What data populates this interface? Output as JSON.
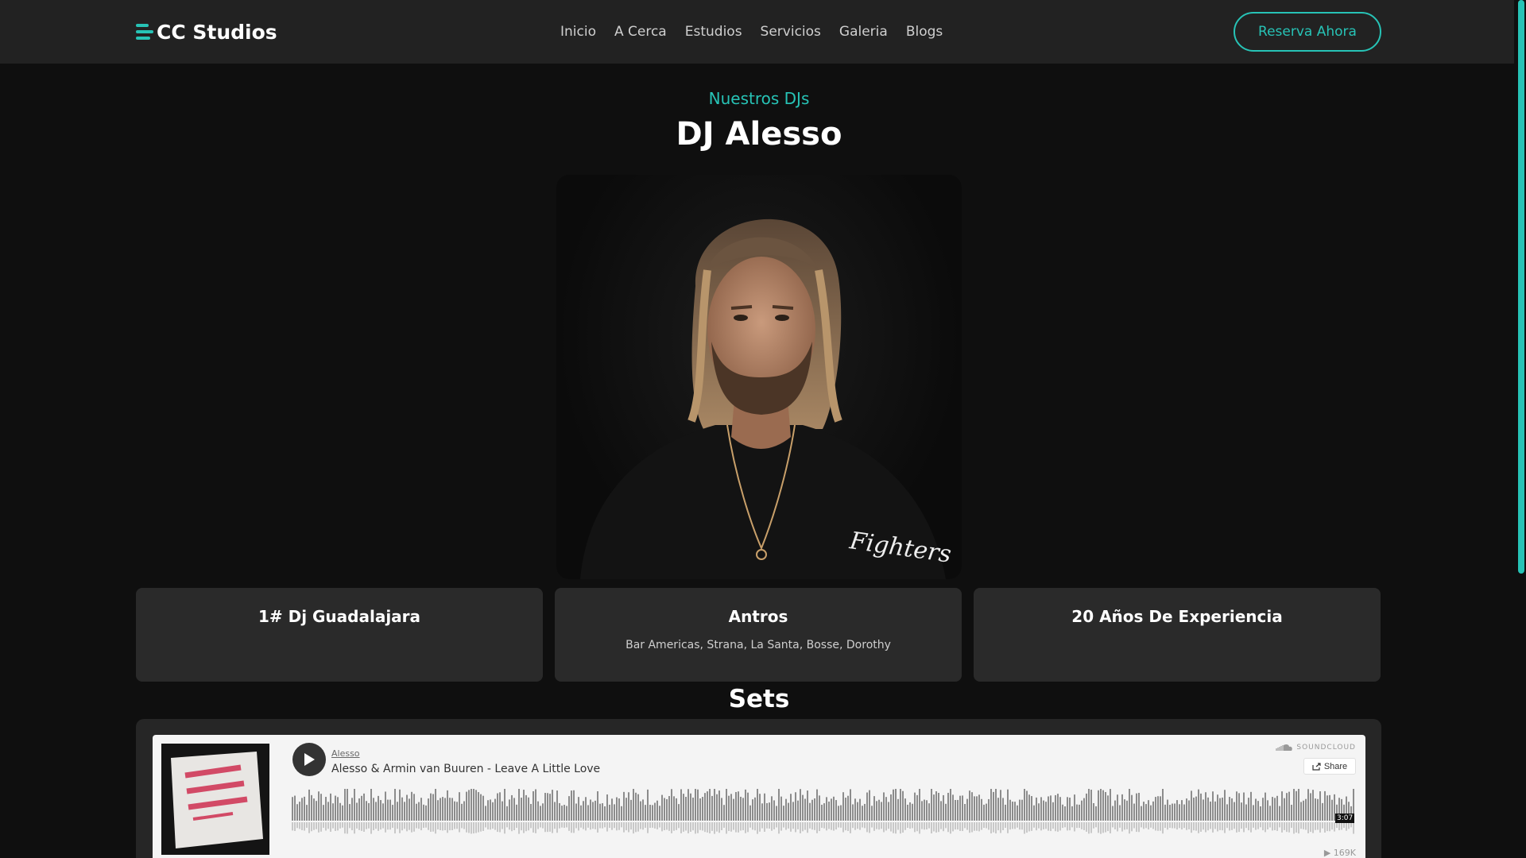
{
  "header": {
    "logo_text": "CC Studios",
    "nav": [
      {
        "label": "Inicio"
      },
      {
        "label": "A Cerca"
      },
      {
        "label": "Estudios"
      },
      {
        "label": "Servicios"
      },
      {
        "label": "Galeria"
      },
      {
        "label": "Blogs"
      }
    ],
    "cta_label": "Reserva Ahora"
  },
  "hero": {
    "eyebrow": "Nuestros DJs",
    "title": "DJ Alesso",
    "shirt_text": "Fighters"
  },
  "cards": [
    {
      "title": "1# Dj Guadalajara",
      "text": ""
    },
    {
      "title": "Antros",
      "text": "Bar Americas, Strana, La Santa, Bosse, Dorothy"
    },
    {
      "title": "20 Años De Experiencia",
      "text": ""
    }
  ],
  "sets": {
    "title": "Sets",
    "player": {
      "artist": "Alesso",
      "track": "Alesso & Armin van Buuren - Leave A Little Love",
      "brand": "SOUNDCLOUD",
      "share_label": "Share",
      "duration": "3:07",
      "plays": "169K"
    }
  },
  "colors": {
    "accent": "#27c3b6",
    "header_bg": "#222222",
    "page_bg": "#0f0f0f",
    "card_bg": "#2a2a2a"
  }
}
